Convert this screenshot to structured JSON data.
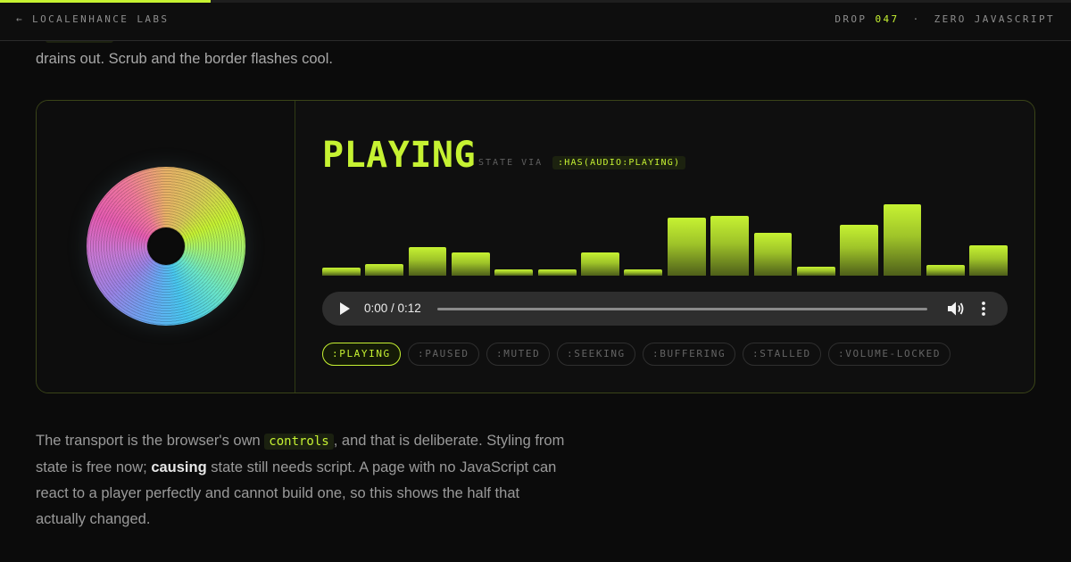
{
  "colors": {
    "accent": "#c6f232",
    "background": "#0b0b0b",
    "card_border": "#3a4418"
  },
  "topbar": {
    "progress": 0.197,
    "back_link": "← LOCALENHANCE LABS",
    "drop_label": "DROP",
    "drop_number": "047",
    "separator": "·",
    "tagline": "ZERO JAVASCRIPT"
  },
  "intro": {
    "line2": "drains out. Scrub and the border flashes cool."
  },
  "player": {
    "state": "PLAYING",
    "state_via_label": "STATE VIA",
    "state_selector": ":HAS(AUDIO:PLAYING)",
    "visualizer_levels": [
      0.1,
      0.15,
      0.37,
      0.3,
      0.08,
      0.08,
      0.3,
      0.08,
      0.76,
      0.78,
      0.56,
      0.12,
      0.66,
      0.93,
      0.14,
      0.39
    ],
    "audio": {
      "play_icon": "play-icon",
      "time": "0:00 / 0:12",
      "progress": 0.0,
      "volume_icon": "volume-icon",
      "more_icon": "more-options-icon"
    },
    "pills": [
      {
        "label": ":PLAYING",
        "active": true
      },
      {
        "label": ":PAUSED",
        "active": false
      },
      {
        "label": ":MUTED",
        "active": false
      },
      {
        "label": ":SEEKING",
        "active": false
      },
      {
        "label": ":BUFFERING",
        "active": false
      },
      {
        "label": ":STALLED",
        "active": false
      },
      {
        "label": ":VOLUME-LOCKED",
        "active": false
      }
    ]
  },
  "body": {
    "p1_before": "The transport is the browser's own",
    "p1_code": "controls",
    "p1_after": ", and that is deliberate. Styling from state is free now;",
    "p1_strong": "causing",
    "p1_end": "state still needs script. A page with no JavaScript can react to a player perfectly and cannot build one, so this shows the half that actually changed."
  }
}
